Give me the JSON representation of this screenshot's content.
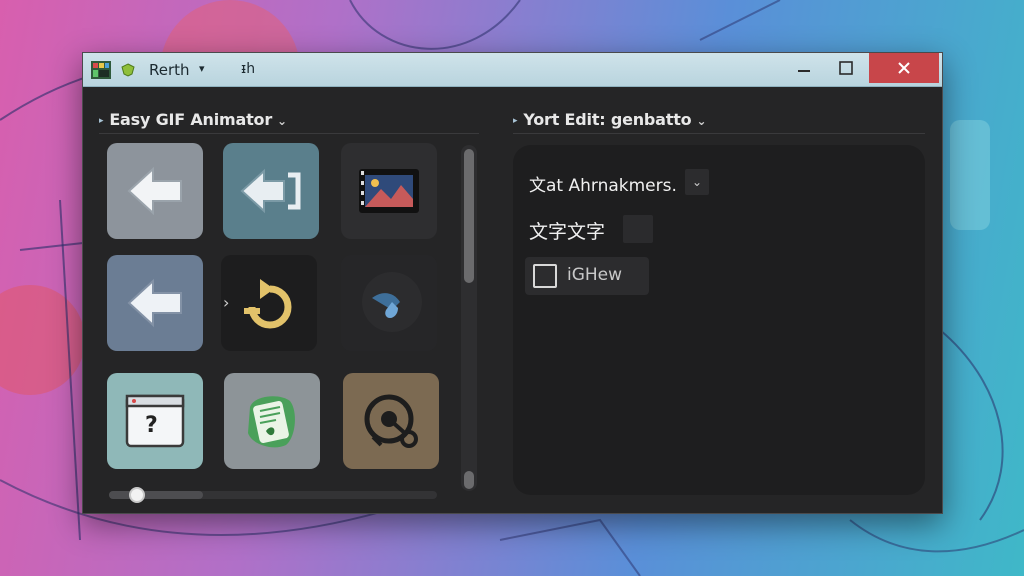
{
  "window": {
    "title": "Rerth",
    "title_caret": "▾",
    "pin_glyph": "ᵻh",
    "controls": {
      "minimize_icon": "minimize-icon",
      "maximize_icon": "maximize-icon",
      "close_icon": "close-icon"
    }
  },
  "left_pane": {
    "title": "Easy GIF Animator",
    "title_arrow": "▸",
    "title_chevron": "⌄",
    "tiles": [
      {
        "icon": "arrow-left-icon"
      },
      {
        "icon": "arrow-left-bracket-icon"
      },
      {
        "icon": "film-image-icon"
      },
      {
        "icon": "arrow-left-icon"
      },
      {
        "icon": "rotate-refresh-icon",
        "prefix": "›"
      },
      {
        "icon": "water-drop-icon"
      },
      {
        "icon": "help-window-icon",
        "text": "?"
      },
      {
        "icon": "document-leaf-icon"
      },
      {
        "icon": "dial-tool-icon"
      }
    ],
    "hscroll": {
      "value": 0.06
    }
  },
  "right_pane": {
    "title": "Yort Edit: genbatto",
    "title_arrow": "▸",
    "title_chevron": "⌄",
    "field1_text": "文at Ahrnakmers.",
    "field1_dropdown": "⌄",
    "field2_text": "文字文字",
    "checkbox_label": "iGHew",
    "checkbox_checked": false
  },
  "colors": {
    "window_bg": "#252526",
    "titlebar": "#c4dce4",
    "close_button": "#c8464a",
    "panel_bg": "#1e1e1f"
  }
}
